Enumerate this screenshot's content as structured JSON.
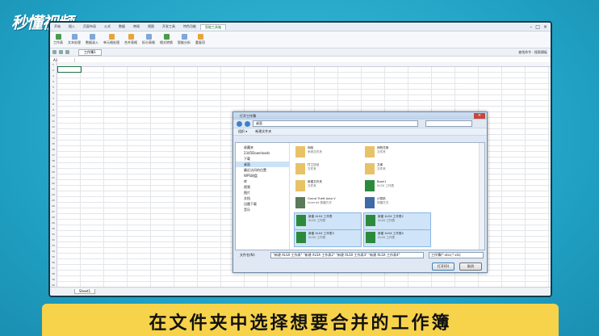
{
  "branding": {
    "logo": "秒懂视频"
  },
  "caption": "在文件夹中选择想要合并的工作簿",
  "excel": {
    "tabs": [
      "开始",
      "插入",
      "页面布局",
      "公式",
      "数据",
      "审阅",
      "视图",
      "开发工具",
      "特色功能",
      "智能工具箱"
    ],
    "ribbon_buttons": [
      "工作表",
      "文本处理",
      "数据录入",
      "单元格处理",
      "合并表格",
      "拆分表格",
      "格式转换",
      "智能分析",
      "重复项"
    ],
    "file_tab": "工作簿1",
    "namebox": "A1",
    "sheet_tab": "Sheet1",
    "right_info": "查找命令 · 搜索模板"
  },
  "dialog": {
    "title": "打开工作簿",
    "address": "桌面",
    "toolbar": [
      "组织 ▾",
      "新建文件夹"
    ],
    "nav": [
      "收藏夹",
      "2345Downloads",
      "下载",
      "桌面",
      "最近访问的位置",
      "WPS网盘",
      "库",
      "视频",
      "图片",
      "文档",
      "迅雷下载",
      "音乐"
    ],
    "nav_selected": 3,
    "files": [
      {
        "name": "网络",
        "sub": "系统文件夹",
        "icon": "folder"
      },
      {
        "name": "网购兑换",
        "sub": "文件夹",
        "icon": "folder"
      },
      {
        "name": "打工日记",
        "sub": "文件夹",
        "icon": "folder"
      },
      {
        "name": "文案",
        "sub": "文件夹",
        "icon": "folder"
      },
      {
        "name": "新建文件夹",
        "sub": "文件夹",
        "icon": "folder"
      },
      {
        "name": "Book1",
        "sub": "XLSX 工作表",
        "icon": "xls"
      },
      {
        "name": "Grand Theft Auto V",
        "sub": "Internet 快捷方式",
        "icon": "app"
      },
      {
        "name": "计算机",
        "sub": "快捷方式",
        "icon": "pc"
      },
      {
        "name": "新建 XLSX 工作表",
        "sub": "XLSX 工作表",
        "icon": "xls",
        "selected": true
      },
      {
        "name": "新建 XLSX 工作表2",
        "sub": "XLSX 工作表",
        "icon": "xls",
        "selected": true
      },
      {
        "name": "新建 XLSX 工作表3",
        "sub": "XLSX 工作表",
        "icon": "xls",
        "selected": true
      },
      {
        "name": "新建 XLSX 工作表4",
        "sub": "XLSX 工作表",
        "icon": "xls",
        "selected": true
      }
    ],
    "filename_label": "文件名(N):",
    "filename_value": "\"新建 XLSX 工作表\" \"新建 XLSX 工作表2\" \"新建 XLSX 工作表3\" \"新建 XLSX 工作表4\"",
    "filetype": "工作簿(*.xlsx;*.xls)",
    "open_button": "打开(O)",
    "cancel_button": "取消"
  }
}
